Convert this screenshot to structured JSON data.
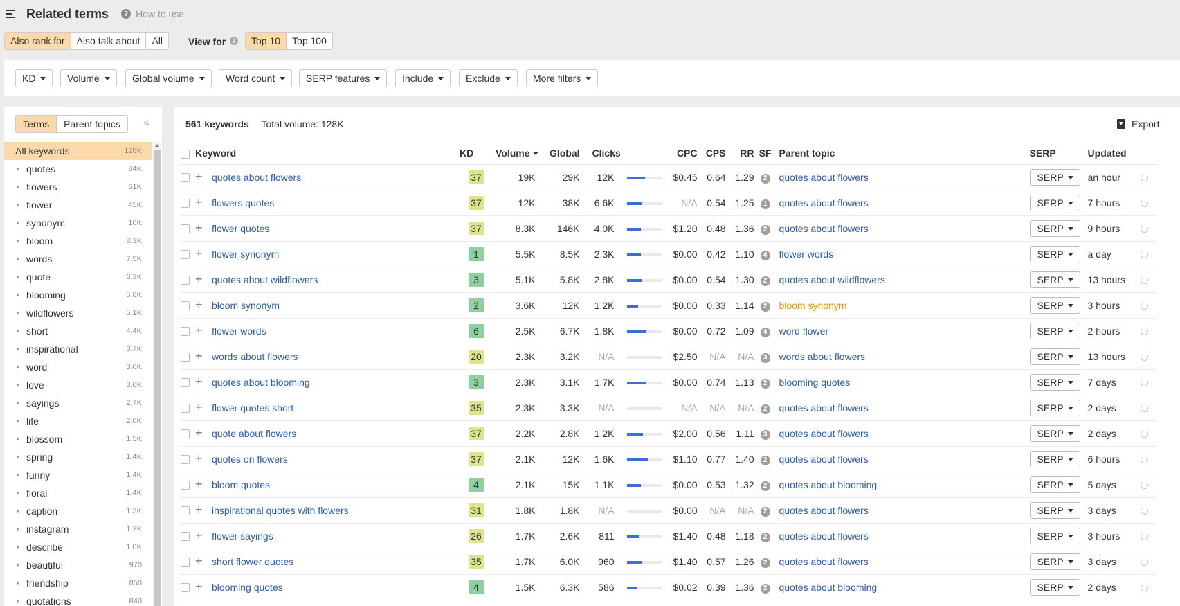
{
  "header": {
    "title": "Related terms",
    "help_label": "How to use"
  },
  "mode_tabs": [
    {
      "label": "Also rank for",
      "active": true
    },
    {
      "label": "Also talk about",
      "active": false
    },
    {
      "label": "All",
      "active": false
    }
  ],
  "view_for": {
    "label": "View for",
    "options": [
      {
        "label": "Top 10",
        "active": true
      },
      {
        "label": "Top 100",
        "active": false
      }
    ]
  },
  "filters": [
    "KD",
    "Volume",
    "Global volume",
    "Word count",
    "SERP features",
    "Include",
    "Exclude",
    "More filters"
  ],
  "sidebar": {
    "tabs": [
      {
        "label": "Terms",
        "active": true
      },
      {
        "label": "Parent topics",
        "active": false
      }
    ],
    "collapse_icon": "double-chevron-left-icon",
    "items": [
      {
        "label": "All keywords",
        "count": "128K"
      },
      {
        "label": "quotes",
        "count": "84K"
      },
      {
        "label": "flowers",
        "count": "61K"
      },
      {
        "label": "flower",
        "count": "45K"
      },
      {
        "label": "synonym",
        "count": "10K"
      },
      {
        "label": "bloom",
        "count": "8.3K"
      },
      {
        "label": "words",
        "count": "7.5K"
      },
      {
        "label": "quote",
        "count": "6.3K"
      },
      {
        "label": "blooming",
        "count": "5.8K"
      },
      {
        "label": "wildflowers",
        "count": "5.1K"
      },
      {
        "label": "short",
        "count": "4.4K"
      },
      {
        "label": "inspirational",
        "count": "3.7K"
      },
      {
        "label": "word",
        "count": "3.0K"
      },
      {
        "label": "love",
        "count": "3.0K"
      },
      {
        "label": "sayings",
        "count": "2.7K"
      },
      {
        "label": "life",
        "count": "2.0K"
      },
      {
        "label": "blossom",
        "count": "1.5K"
      },
      {
        "label": "spring",
        "count": "1.4K"
      },
      {
        "label": "funny",
        "count": "1.4K"
      },
      {
        "label": "floral",
        "count": "1.4K"
      },
      {
        "label": "caption",
        "count": "1.3K"
      },
      {
        "label": "instagram",
        "count": "1.2K"
      },
      {
        "label": "describe",
        "count": "1.0K"
      },
      {
        "label": "beautiful",
        "count": "970"
      },
      {
        "label": "friendship",
        "count": "850"
      },
      {
        "label": "quotations",
        "count": "840"
      }
    ]
  },
  "summary": {
    "keywords": "561 keywords",
    "total_volume": "Total volume: 128K"
  },
  "export_label": "Export",
  "table": {
    "columns": [
      "Keyword",
      "KD",
      "Volume",
      "Global",
      "Clicks",
      "CPC",
      "CPS",
      "RR",
      "SF",
      "Parent topic",
      "SERP",
      "Updated"
    ],
    "serp_label": "SERP",
    "colors": {
      "kd_green": "#8fd19e",
      "kd_yellow": "#dde58a",
      "link": "#2a5db0",
      "orange": "#e8900c",
      "accent": "#fcd9a8"
    },
    "rows": [
      {
        "keyword": "quotes about flowers",
        "kd": "37",
        "volume": "19K",
        "global": "29K",
        "clicks": "12K",
        "clicks_pct": 0.52,
        "cpc": "$0.45",
        "cps": "0.64",
        "rr": "1.29",
        "sf": "2",
        "parent": "quotes about flowers",
        "parent_orange": false,
        "updated": "an hour"
      },
      {
        "keyword": "flowers quotes",
        "kd": "37",
        "volume": "12K",
        "global": "38K",
        "clicks": "6.6K",
        "clicks_pct": 0.44,
        "cpc": "N/A",
        "cps": "0.54",
        "rr": "1.25",
        "sf": "1",
        "parent": "quotes about flowers",
        "parent_orange": false,
        "updated": "7 hours"
      },
      {
        "keyword": "flower quotes",
        "kd": "37",
        "volume": "8.3K",
        "global": "146K",
        "clicks": "4.0K",
        "clicks_pct": 0.4,
        "cpc": "$1.20",
        "cps": "0.48",
        "rr": "1.36",
        "sf": "2",
        "parent": "quotes about flowers",
        "parent_orange": false,
        "updated": "9 hours"
      },
      {
        "keyword": "flower synonym",
        "kd": "1",
        "volume": "5.5K",
        "global": "8.5K",
        "clicks": "2.3K",
        "clicks_pct": 0.4,
        "cpc": "$0.00",
        "cps": "0.42",
        "rr": "1.10",
        "sf": "4",
        "parent": "flower words",
        "parent_orange": false,
        "updated": "a day"
      },
      {
        "keyword": "quotes about wildflowers",
        "kd": "3",
        "volume": "5.1K",
        "global": "5.8K",
        "clicks": "2.8K",
        "clicks_pct": 0.44,
        "cpc": "$0.00",
        "cps": "0.54",
        "rr": "1.30",
        "sf": "2",
        "parent": "quotes about wildflowers",
        "parent_orange": false,
        "updated": "13 hours"
      },
      {
        "keyword": "bloom synonym",
        "kd": "2",
        "volume": "3.6K",
        "global": "12K",
        "clicks": "1.2K",
        "clicks_pct": 0.32,
        "cpc": "$0.00",
        "cps": "0.33",
        "rr": "1.14",
        "sf": "2",
        "parent": "bloom synonym",
        "parent_orange": true,
        "updated": "3 hours"
      },
      {
        "keyword": "flower words",
        "kd": "6",
        "volume": "2.5K",
        "global": "6.7K",
        "clicks": "1.8K",
        "clicks_pct": 0.56,
        "cpc": "$0.00",
        "cps": "0.72",
        "rr": "1.09",
        "sf": "4",
        "parent": "word flower",
        "parent_orange": false,
        "updated": "2 hours"
      },
      {
        "keyword": "words about flowers",
        "kd": "20",
        "volume": "2.3K",
        "global": "3.2K",
        "clicks": "N/A",
        "clicks_pct": 0,
        "cpc": "$2.50",
        "cps": "N/A",
        "rr": "N/A",
        "sf": "3",
        "parent": "words about flowers",
        "parent_orange": false,
        "updated": "13 hours"
      },
      {
        "keyword": "quotes about blooming",
        "kd": "3",
        "volume": "2.3K",
        "global": "3.1K",
        "clicks": "1.7K",
        "clicks_pct": 0.54,
        "cpc": "$0.00",
        "cps": "0.74",
        "rr": "1.13",
        "sf": "2",
        "parent": "blooming quotes",
        "parent_orange": false,
        "updated": "7 days"
      },
      {
        "keyword": "flower quotes short",
        "kd": "35",
        "volume": "2.3K",
        "global": "3.3K",
        "clicks": "N/A",
        "clicks_pct": 0,
        "cpc": "N/A",
        "cps": "N/A",
        "rr": "N/A",
        "sf": "2",
        "parent": "quotes about flowers",
        "parent_orange": false,
        "updated": "2 days"
      },
      {
        "keyword": "quote about flowers",
        "kd": "37",
        "volume": "2.2K",
        "global": "2.8K",
        "clicks": "1.2K",
        "clicks_pct": 0.46,
        "cpc": "$2.00",
        "cps": "0.56",
        "rr": "1.11",
        "sf": "3",
        "parent": "quotes about flowers",
        "parent_orange": false,
        "updated": "2 days"
      },
      {
        "keyword": "quotes on flowers",
        "kd": "37",
        "volume": "2.1K",
        "global": "12K",
        "clicks": "1.6K",
        "clicks_pct": 0.6,
        "cpc": "$1.10",
        "cps": "0.77",
        "rr": "1.40",
        "sf": "2",
        "parent": "quotes about flowers",
        "parent_orange": false,
        "updated": "6 hours"
      },
      {
        "keyword": "bloom quotes",
        "kd": "4",
        "volume": "2.1K",
        "global": "15K",
        "clicks": "1.1K",
        "clicks_pct": 0.4,
        "cpc": "$0.00",
        "cps": "0.53",
        "rr": "1.32",
        "sf": "2",
        "parent": "quotes about blooming",
        "parent_orange": false,
        "updated": "5 days"
      },
      {
        "keyword": "inspirational quotes with flowers",
        "kd": "31",
        "volume": "1.8K",
        "global": "1.8K",
        "clicks": "N/A",
        "clicks_pct": 0,
        "cpc": "$0.00",
        "cps": "N/A",
        "rr": "N/A",
        "sf": "2",
        "parent": "quotes about flowers",
        "parent_orange": false,
        "updated": "3 days"
      },
      {
        "keyword": "flower sayings",
        "kd": "26",
        "volume": "1.7K",
        "global": "2.6K",
        "clicks": "811",
        "clicks_pct": 0.36,
        "cpc": "$1.40",
        "cps": "0.48",
        "rr": "1.18",
        "sf": "2",
        "parent": "quotes about flowers",
        "parent_orange": false,
        "updated": "3 hours"
      },
      {
        "keyword": "short flower quotes",
        "kd": "35",
        "volume": "1.7K",
        "global": "6.0K",
        "clicks": "960",
        "clicks_pct": 0.44,
        "cpc": "$1.40",
        "cps": "0.57",
        "rr": "1.26",
        "sf": "2",
        "parent": "quotes about flowers",
        "parent_orange": false,
        "updated": "3 days"
      },
      {
        "keyword": "blooming quotes",
        "kd": "4",
        "volume": "1.5K",
        "global": "6.3K",
        "clicks": "586",
        "clicks_pct": 0.3,
        "cpc": "$0.02",
        "cps": "0.39",
        "rr": "1.36",
        "sf": "2",
        "parent": "quotes about blooming",
        "parent_orange": false,
        "updated": "2 days"
      }
    ]
  }
}
